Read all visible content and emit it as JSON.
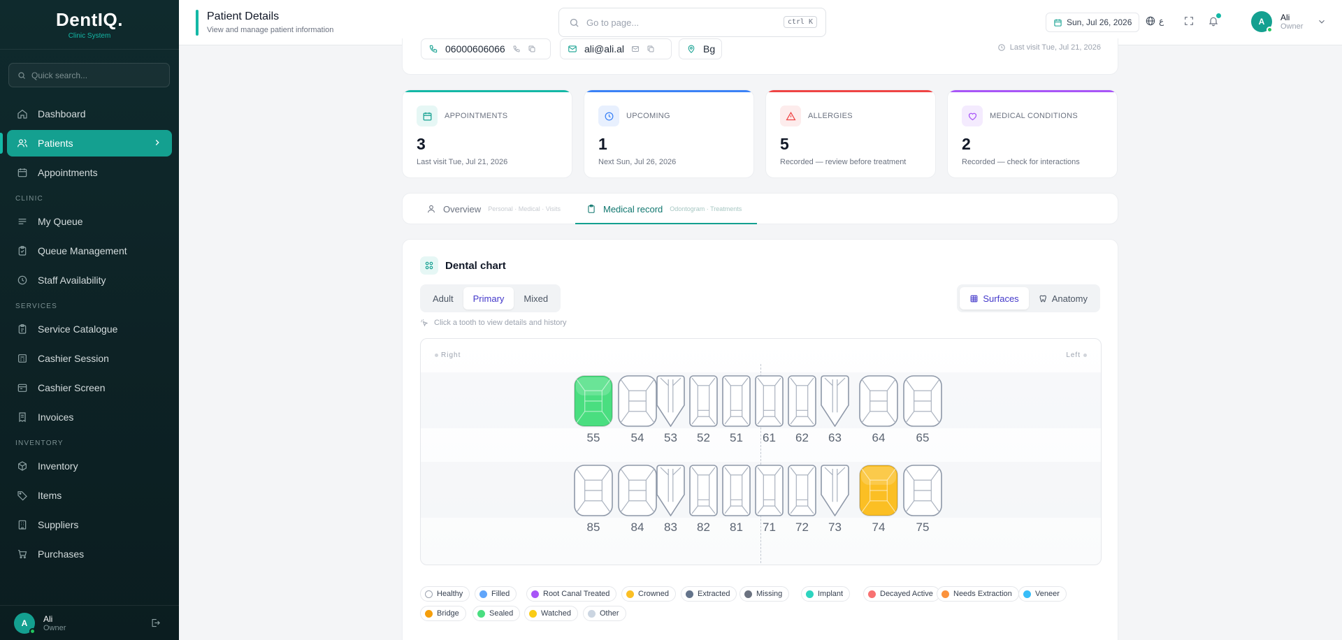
{
  "app": {
    "brand": "DentIQ.",
    "brand_sub": "Clinic System"
  },
  "sidebar": {
    "search_placeholder": "Quick search...",
    "sections": {
      "clinic": "CLINIC",
      "services": "SERVICES",
      "inventory": "INVENTORY"
    },
    "items": {
      "dashboard": "Dashboard",
      "patients": "Patients",
      "appointments": "Appointments",
      "my_queue": "My Queue",
      "queue_management": "Queue Management",
      "staff_availability": "Staff Availability",
      "service_catalogue": "Service Catalogue",
      "cashier_session": "Cashier Session",
      "cashier_screen": "Cashier Screen",
      "invoices": "Invoices",
      "inventory": "Inventory",
      "items": "Items",
      "suppliers": "Suppliers",
      "purchases": "Purchases"
    },
    "user": {
      "initial": "A",
      "name": "Ali",
      "role": "Owner"
    }
  },
  "header": {
    "title": "Patient Details",
    "subtitle": "View and manage patient information",
    "goto_placeholder": "Go to page...",
    "shortcut": "ctrl K",
    "date": "Sun, Jul 26, 2026",
    "lang_letter": "ع",
    "user": {
      "initial": "A",
      "name": "Ali",
      "role": "Owner"
    }
  },
  "contact": {
    "phone": "06000606066",
    "email": "ali@ali.al",
    "location": "Bg",
    "last_visit": "Last visit Tue, Jul 21, 2026"
  },
  "stats": [
    {
      "label": "APPOINTMENTS",
      "value": "3",
      "note": "Last visit Tue, Jul 21, 2026",
      "color": "#14b8a6"
    },
    {
      "label": "UPCOMING",
      "value": "1",
      "note": "Next Sun, Jul 26, 2026",
      "color": "#3b82f6"
    },
    {
      "label": "ALLERGIES",
      "value": "5",
      "note": "Recorded — review before treatment",
      "color": "#ef4444"
    },
    {
      "label": "MEDICAL CONDITIONS",
      "value": "2",
      "note": "Recorded — check for interactions",
      "color": "#a855f7"
    }
  ],
  "tabs": [
    {
      "label": "Overview",
      "hint": "Personal · Medical · Visits"
    },
    {
      "label": "Medical record",
      "hint": "Odontogram · Treatments"
    }
  ],
  "dental_chart": {
    "title": "Dental chart",
    "dentition_modes": [
      "Adult",
      "Primary",
      "Mixed"
    ],
    "active_mode": "Primary",
    "views": [
      "Surfaces",
      "Anatomy"
    ],
    "active_view": "Surfaces",
    "hint": "Click a tooth to view details and history",
    "side_right": "Right",
    "side_left": "Left",
    "upper": [
      {
        "num": "55",
        "type": "molar",
        "status": "sealed"
      },
      {
        "num": "54",
        "type": "molar",
        "status": "none"
      },
      {
        "num": "53",
        "type": "canine",
        "status": "none"
      },
      {
        "num": "52",
        "type": "incisor",
        "status": "none"
      },
      {
        "num": "51",
        "type": "incisor",
        "status": "none"
      },
      {
        "num": "61",
        "type": "incisor",
        "status": "none"
      },
      {
        "num": "62",
        "type": "incisor",
        "status": "none"
      },
      {
        "num": "63",
        "type": "canine",
        "status": "none"
      },
      {
        "num": "64",
        "type": "molar",
        "status": "none"
      },
      {
        "num": "65",
        "type": "molar",
        "status": "none"
      }
    ],
    "lower": [
      {
        "num": "85",
        "type": "molar",
        "status": "none"
      },
      {
        "num": "84",
        "type": "molar",
        "status": "none"
      },
      {
        "num": "83",
        "type": "canine",
        "status": "none"
      },
      {
        "num": "82",
        "type": "incisor",
        "status": "none"
      },
      {
        "num": "81",
        "type": "incisor",
        "status": "none"
      },
      {
        "num": "71",
        "type": "incisor",
        "status": "none"
      },
      {
        "num": "72",
        "type": "incisor",
        "status": "none"
      },
      {
        "num": "73",
        "type": "canine",
        "status": "none"
      },
      {
        "num": "74",
        "type": "molar",
        "status": "crowned"
      },
      {
        "num": "75",
        "type": "molar",
        "status": "none"
      }
    ],
    "legend": [
      {
        "label": "Healthy",
        "color": "#ffffff"
      },
      {
        "label": "Filled",
        "color": "#60a5fa"
      },
      {
        "label": "Root Canal Treated",
        "color": "#a855f7"
      },
      {
        "label": "Crowned",
        "color": "#fbbf24"
      },
      {
        "label": "Extracted",
        "color": "#64748b"
      },
      {
        "label": "Missing",
        "color": "#6b7280"
      },
      {
        "label": "Implant",
        "color": "#2dd4bf"
      },
      {
        "label": "Decayed Active",
        "color": "#f87171"
      },
      {
        "label": "Needs Extraction",
        "color": "#fb923c"
      },
      {
        "label": "Veneer",
        "color": "#38bdf8"
      },
      {
        "label": "Bridge",
        "color": "#f59e0b"
      },
      {
        "label": "Sealed",
        "color": "#4ade80"
      },
      {
        "label": "Watched",
        "color": "#facc15"
      },
      {
        "label": "Other",
        "color": "#cbd5e1"
      }
    ]
  },
  "colors": {
    "accent": "#14a090",
    "sealed_fill": "#4ade80",
    "crowned_fill": "#fbbf24",
    "mode_active": "#4338ca"
  }
}
